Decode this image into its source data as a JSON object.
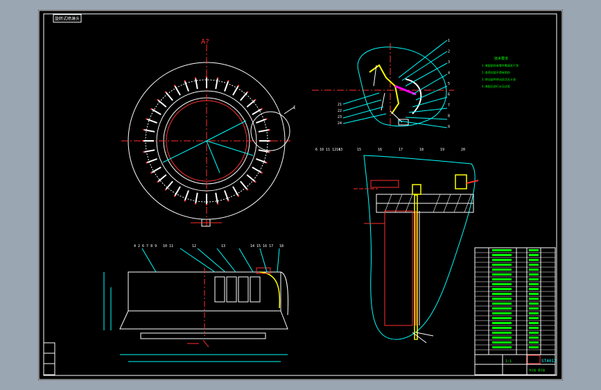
{
  "drawing": {
    "corner_label": "旋转式喷淋头",
    "view_label": "A?",
    "detail_label": "I",
    "part_numbers_right_detail": [
      "1",
      "2",
      "3",
      "4",
      "5",
      "6",
      "7",
      "8",
      "9"
    ],
    "part_numbers_left_detail": [
      "21",
      "22",
      "23",
      "24"
    ],
    "section_callouts": [
      "6 10 11 12 13",
      "14",
      "15",
      "16",
      "17",
      "18",
      "19",
      "20"
    ],
    "bottom_callouts": [
      "4 2 6 7 8 9",
      "10 11",
      "12",
      "13",
      "14 15 16 17",
      "18"
    ],
    "title_block": {
      "scale_label": "1:1",
      "drawing_no": "ST4012",
      "sheet": "共1张 第1张"
    },
    "notes_title": "技术要求",
    "notes": [
      "1.装配前所有零件需清洗干净",
      "2.各密封面不得有划伤",
      "3.转动部件转动灵活无卡滞",
      "4.装配后进行水压试验"
    ]
  },
  "colors": {
    "background": "#000000",
    "frame": "#ffffff",
    "line_white": "#ffffff",
    "line_cyan": "#00ffff",
    "line_red": "#ff3030",
    "line_yellow": "#ffff00",
    "line_magenta": "#ff00ff",
    "line_green": "#00ff00",
    "window": "#9aa6b2"
  }
}
